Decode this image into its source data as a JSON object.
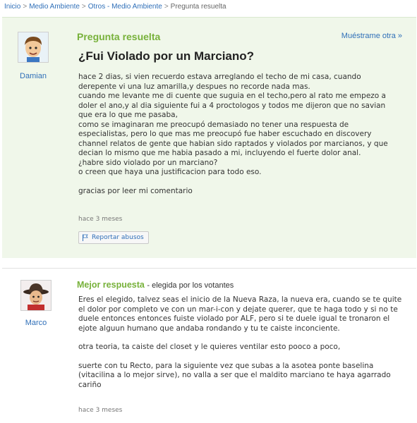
{
  "breadcrumb": {
    "items": [
      "Inicio",
      "Medio Ambiente",
      "Otros - Medio Ambiente"
    ],
    "separator": ">",
    "current": "Pregunta resuelta"
  },
  "question": {
    "status": "Pregunta resuelta",
    "show_other": "Muéstrame otra »",
    "title": "¿Fui Violado por un Marciano?",
    "user": "Damian",
    "body_lines": [
      "hace 2 dias, si vien recuerdo estava arreglando el techo de mi casa, cuando",
      "derepente vi una luz amarilla,y despues no recorde nada mas.",
      "cuando me levante me di cuente que suguia en el techo,pero al rato me empezo a",
      "doler el ano,y al dia siguiente fui a 4 proctologos y todos me dijeron que no savian",
      "que era lo que me pasaba,",
      "como se imaginaran me preocupó demasiado no tener una respuesta de",
      "especialistas, pero lo que mas me preocupó fue haber escuchado en discovery",
      "channel relatos de gente que habian sido raptados y violados por marcianos, y que",
      "decian lo mismo que me habia pasado a mi, incluyendo el fuerte dolor anal.",
      "¿habre sido violado por un marciano?",
      "o creen que haya una justificacion para todo eso."
    ],
    "closing": "gracias por leer mi comentario",
    "time": "hace 3 meses",
    "report_label": "Reportar abusos"
  },
  "answer": {
    "label": "Mejor respuesta",
    "chosen_by": "- elegida por los votantes",
    "user": "Marco",
    "para1_lines": [
      "Eres el elegido, talvez seas el inicio de la Nueva Raza, la nueva era, cuando se te quite",
      "el dolor por completo ve con un mar-i-con y dejate querer, que te haga todo y si no te",
      "duele entonces entonces fuiste violado por ALF, pero si te duele igual te tronaron el",
      "ejote alguun humano que andaba rondando y tu te caiste inconciente."
    ],
    "para2": "otra teoria, ta caiste del closet y le quieres ventilar esto pooco a poco,",
    "para3_lines": [
      "suerte con tu Recto, para la siguiente vez que subas a la asotea ponte baselina",
      "(vitacilina a lo mejor sirve), no valla a ser que el maldito marciano te haya agarrado",
      "cariño"
    ],
    "time": "hace 3 meses"
  },
  "colors": {
    "accent_green": "#77b13a",
    "link_blue": "#2f6fb8",
    "question_bg": "#f0f7ea"
  },
  "icons": [
    "avatar-damian",
    "avatar-marco",
    "flag-icon"
  ]
}
